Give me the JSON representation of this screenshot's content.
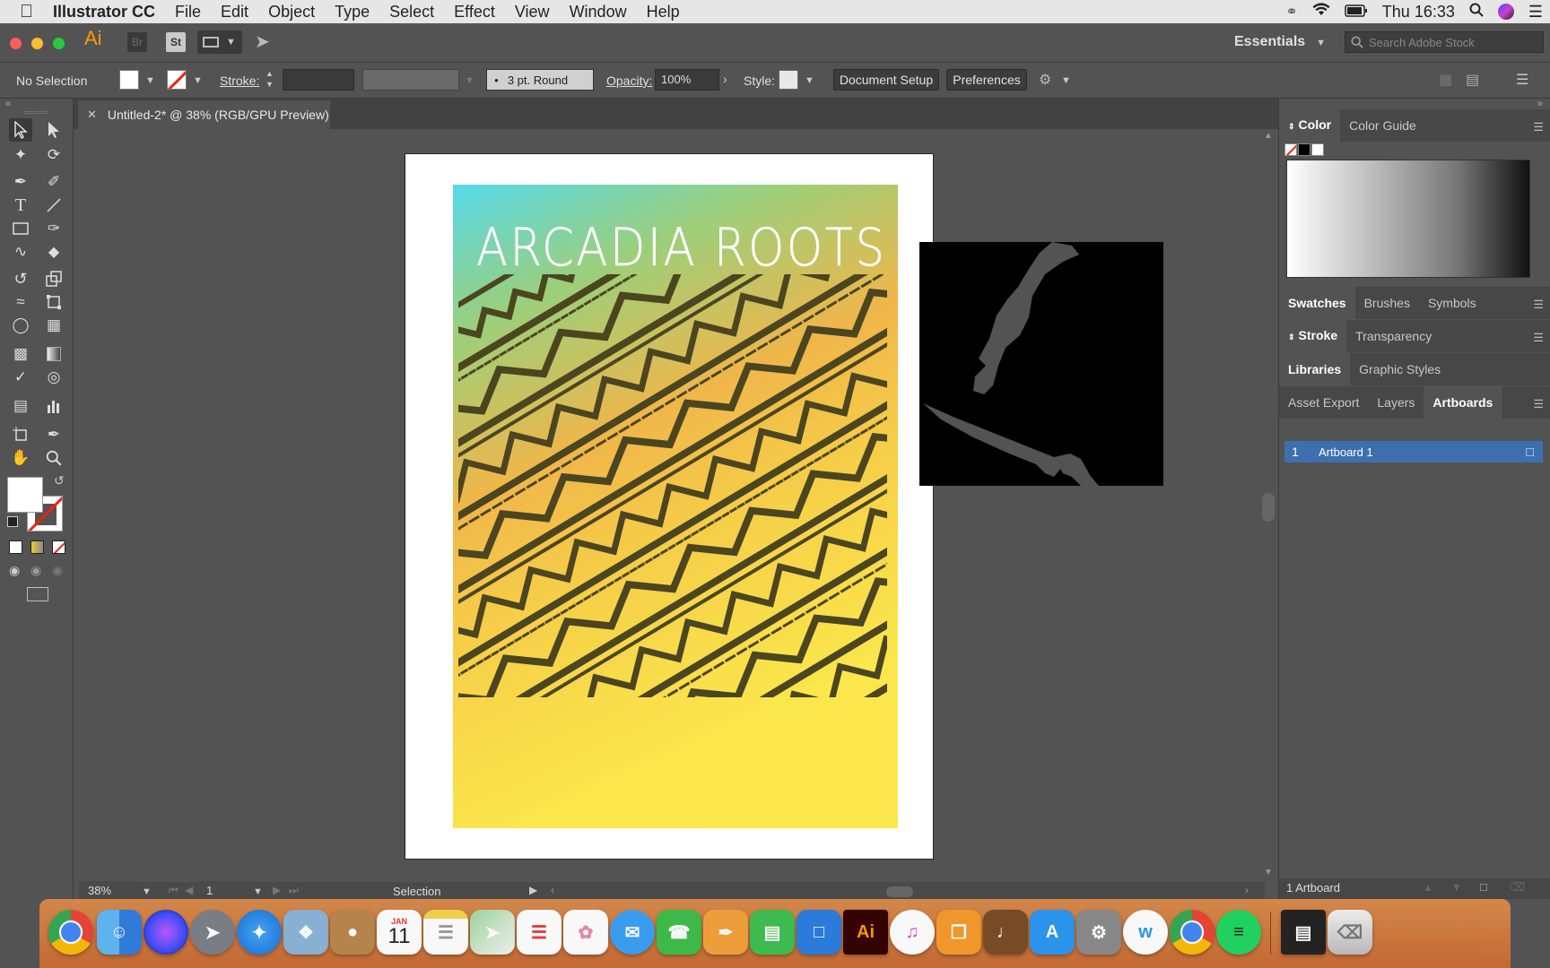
{
  "menubar": {
    "app_name": "Illustrator CC",
    "items": [
      "File",
      "Edit",
      "Object",
      "Type",
      "Select",
      "Effect",
      "View",
      "Window",
      "Help"
    ],
    "clock": "Thu 16:33"
  },
  "appbar": {
    "ai_logo": "Ai",
    "br": "Br",
    "st": "St",
    "workspace": "Essentials",
    "search_placeholder": "Search Adobe Stock"
  },
  "controlbar": {
    "selection": "No Selection",
    "stroke_label": "Stroke:",
    "brush": "3 pt. Round",
    "opacity_label": "Opacity:",
    "opacity_value": "100%",
    "style_label": "Style:",
    "document_setup": "Document Setup",
    "preferences": "Preferences"
  },
  "document": {
    "tab_title": "Untitled-2* @ 38% (RGB/GPU Preview)",
    "artwork_title": "ARCADIA ROOTS"
  },
  "status": {
    "zoom": "38%",
    "artboard_num": "1",
    "tool": "Selection"
  },
  "panels": {
    "color_tabs": [
      "Color",
      "Color Guide"
    ],
    "swatch_tabs": [
      "Swatches",
      "Brushes",
      "Symbols"
    ],
    "stroke_tabs": [
      "Stroke",
      "Transparency"
    ],
    "library_tabs": [
      "Libraries",
      "Graphic Styles"
    ],
    "artboard_tabs": [
      "Asset Export",
      "Layers",
      "Artboards"
    ],
    "artboards": [
      {
        "num": "1",
        "name": "Artboard 1"
      }
    ],
    "footer": "1 Artboard"
  },
  "dock": {
    "calendar_month": "JAN",
    "calendar_day": "11",
    "ai_icon": "Ai"
  },
  "colors": {
    "accent_blue": "#3d6fb0",
    "ai_orange": "#ff9a00",
    "dock": "#d98a4a"
  }
}
